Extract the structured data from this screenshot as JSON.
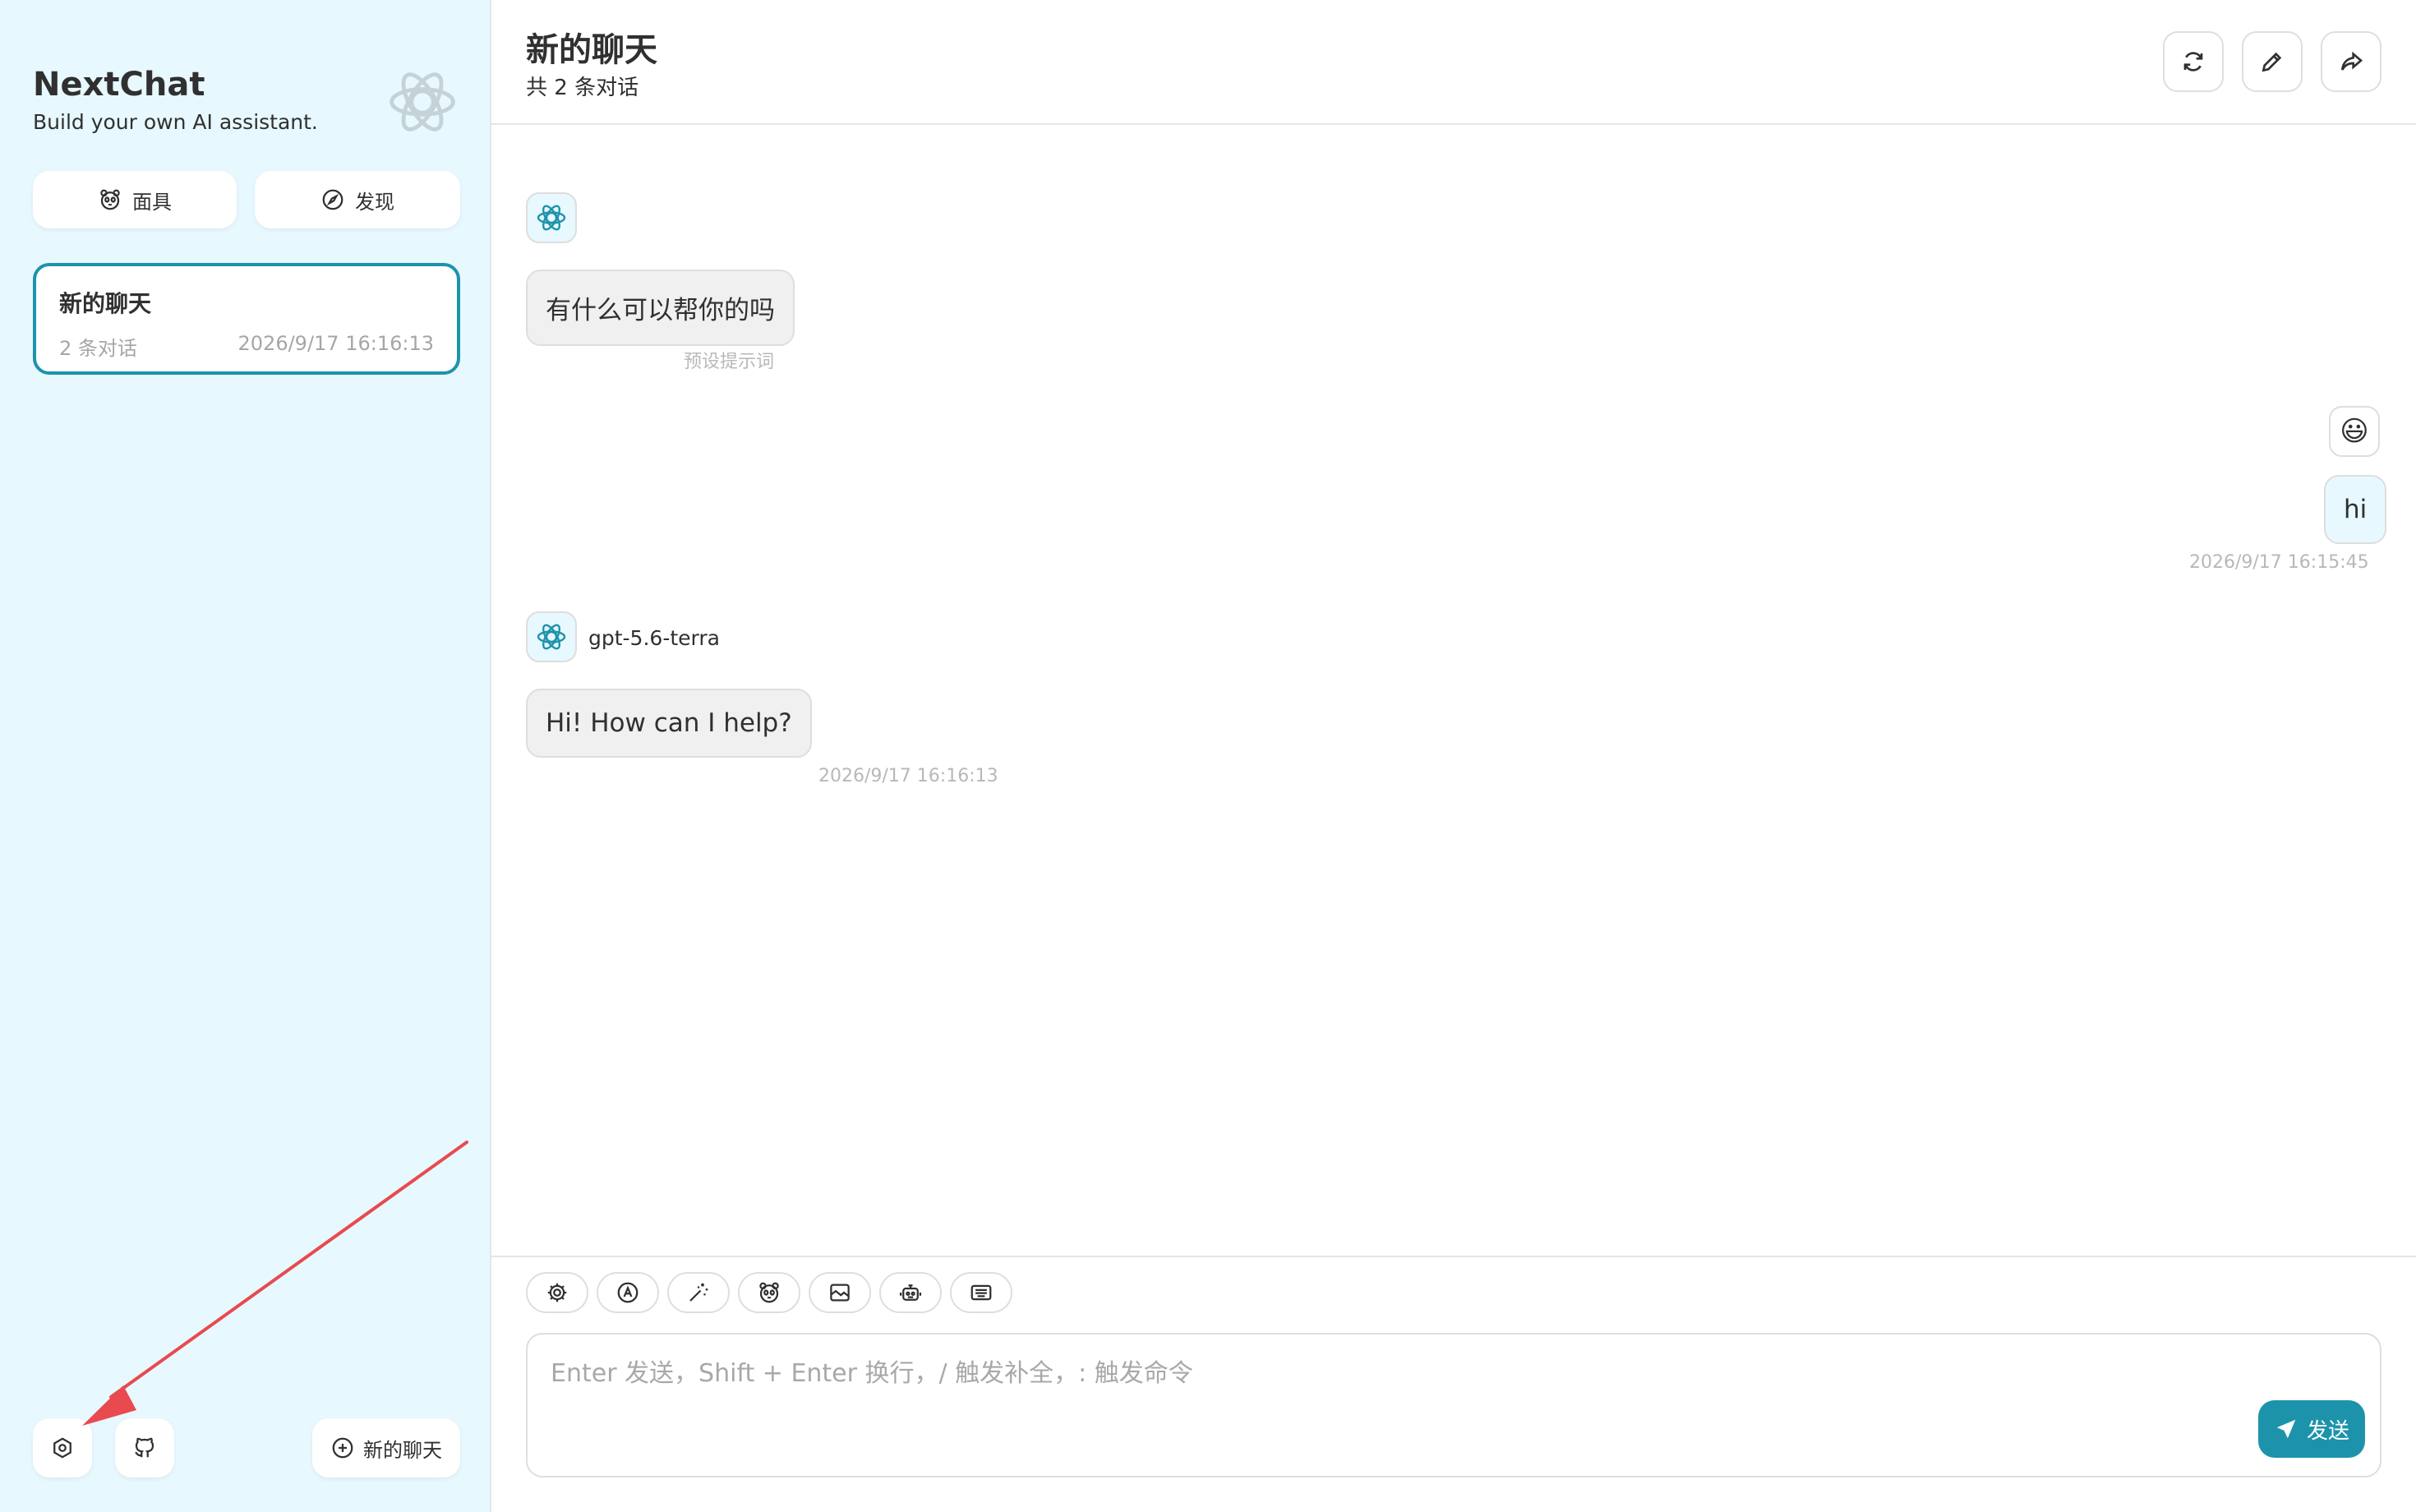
{
  "sidebar": {
    "title": "NextChat",
    "subtitle": "Build your own AI assistant.",
    "mask_label": "面具",
    "discover_label": "发现",
    "chats": [
      {
        "title": "新的聊天",
        "count": "2 条对话",
        "time": "2026/9/17 16:16:13"
      }
    ],
    "new_chat_label": "新的聊天"
  },
  "header": {
    "title": "新的聊天",
    "subtitle": "共 2 条对话"
  },
  "messages": [
    {
      "role": "bot",
      "text": "有什么可以帮你的吗",
      "meta": "预设提示词"
    },
    {
      "role": "user",
      "avatar": "😃",
      "text": "hi",
      "meta": "2026/9/17 16:15:45"
    },
    {
      "role": "bot",
      "model": "gpt-5.6-terra",
      "text": "Hi! How can I help?",
      "meta": "2026/9/17 16:16:13"
    }
  ],
  "composer": {
    "placeholder": "Enter 发送，Shift + Enter 换行，/ 触发补全，: 触发命令",
    "send_label": "发送"
  },
  "colors": {
    "accent": "#1d93ab",
    "sidebar_bg": "#e7f8ff",
    "annotation": "#e84a4f"
  }
}
